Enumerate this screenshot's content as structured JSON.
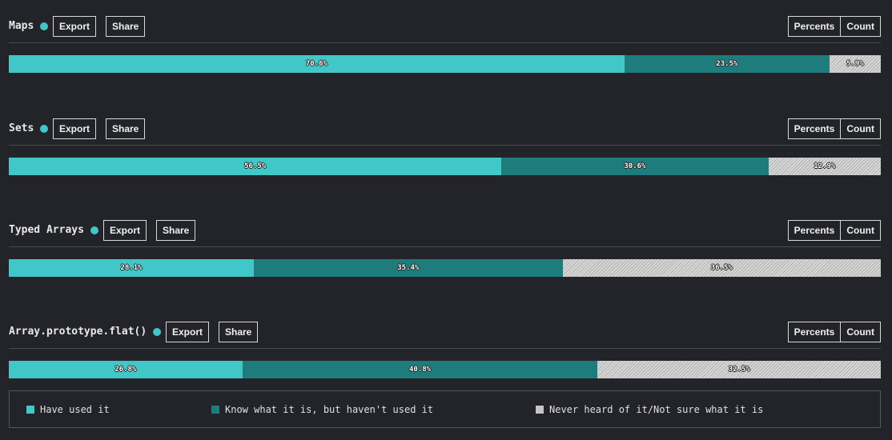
{
  "ui": {
    "export_label": "Export",
    "share_label": "Share",
    "percents_label": "Percents",
    "count_label": "Count"
  },
  "colors": {
    "used": "#41c7c7",
    "know": "#1f7c7c",
    "never": "#c6c6c6",
    "dot": "#41c7c7"
  },
  "chart_data": {
    "type": "bar",
    "stacked": true,
    "orientation": "horizontal",
    "unit": "%",
    "legend_position": "bottom",
    "series": [
      {
        "name": "Have used it",
        "color": "#41c7c7"
      },
      {
        "name": "Know what it is, but haven't used it",
        "color": "#1f7c7c"
      },
      {
        "name": "Never heard of it/Not sure what it is",
        "color": "#c6c6c6"
      }
    ],
    "features": [
      {
        "title": "Maps",
        "values": [
          70.6,
          23.5,
          5.9
        ],
        "labels": [
          "70.6%",
          "23.5%",
          "5.9%"
        ]
      },
      {
        "title": "Sets",
        "values": [
          56.5,
          30.6,
          12.9
        ],
        "labels": [
          "56.5%",
          "30.6%",
          "12.9%"
        ]
      },
      {
        "title": "Typed Arrays",
        "values": [
          28.1,
          35.4,
          36.5
        ],
        "labels": [
          "28.1%",
          "35.4%",
          "36.5%"
        ]
      },
      {
        "title": "Array.prototype.flat()",
        "values": [
          26.8,
          40.8,
          32.5
        ],
        "labels": [
          "26.8%",
          "40.8%",
          "32.5%"
        ]
      }
    ]
  }
}
